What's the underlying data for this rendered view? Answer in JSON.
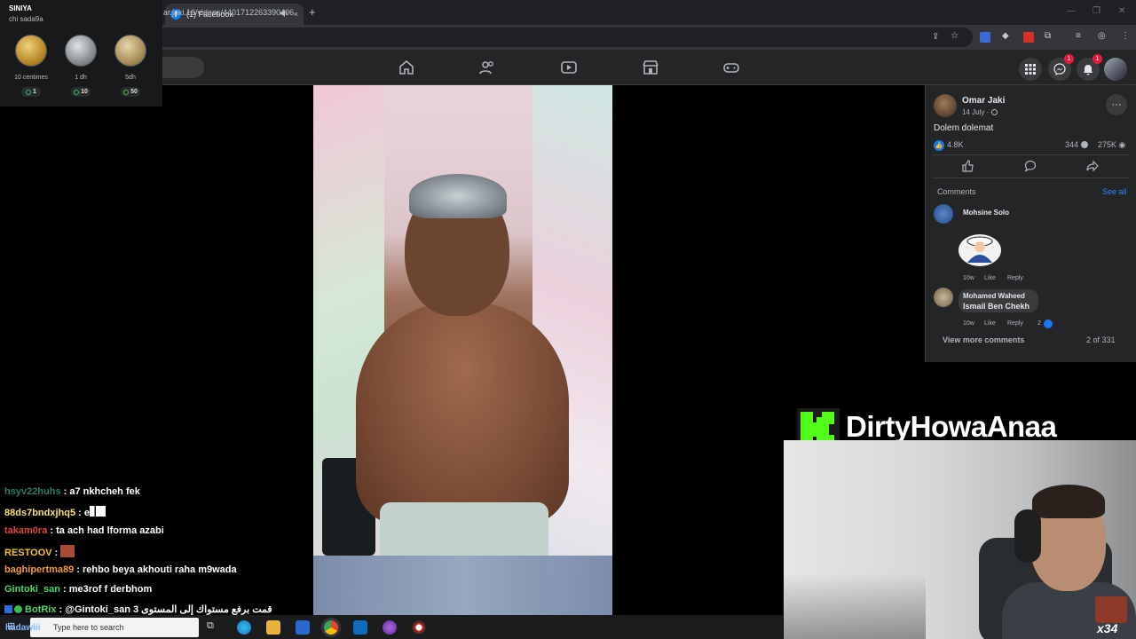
{
  "browser": {
    "tab_title": "(1) Facebook",
    "url": "ar.jaki.16/videos/4401712263390406",
    "tab_audio_icon": "speaker-icon",
    "tab_close": "×",
    "new_tab": "+"
  },
  "coins_widget": {
    "title": "SINIYA",
    "subtitle": "chi sada9a",
    "coins": [
      {
        "label": "10 centimes",
        "points": "1",
        "color": "#c9a23a"
      },
      {
        "label": "1 dh",
        "points": "10",
        "color": "#a0a4a8"
      },
      {
        "label": "5dh",
        "points": "50",
        "color": "#c9b07a"
      }
    ]
  },
  "facebook": {
    "nav_icons": [
      "home-icon",
      "friends-icon",
      "watch-icon",
      "marketplace-icon",
      "gaming-icon"
    ],
    "messenger_badge": "1",
    "notifications_badge": "1"
  },
  "post": {
    "author": "Omar Jaki",
    "date": "14 July ·",
    "more": "···",
    "text": "Dolem dolemat",
    "reactions": "4.8K",
    "comments_count": "344",
    "views": "275K",
    "comments_heading": "Comments",
    "see_all": "See all",
    "comments": [
      {
        "author": "Mohsine Solo",
        "text": "",
        "time": "10w",
        "like": "Like",
        "reply": "Reply",
        "reaction_count": ""
      },
      {
        "author": "Mohamed Waheed",
        "text": "Ismail Ben Chekh",
        "time": "10w",
        "like": "Like",
        "reply": "Reply",
        "reaction_count": "2"
      }
    ],
    "view_more": "View more comments",
    "pagination": "2 of 331"
  },
  "stream": {
    "brand_name": "DirtyHowaAnaa",
    "brand_color": "#53fc18",
    "sub_count": "x34"
  },
  "chat": [
    {
      "user": "hsyv22huhs",
      "color": "#2e7d5b",
      "text": " : a7 nkhcheh fek"
    },
    {
      "user": "88ds7bndxjhq5",
      "color": "#f6e27a",
      "text": " : e"
    },
    {
      "user": "takam0ra",
      "color": "#e0453a",
      "text": " : ta ach had lforma azabi"
    },
    {
      "user": "RESTOOV",
      "color": "#f1c232",
      "text": " : "
    },
    {
      "user": "baghipertma89",
      "color": "#f39c3a",
      "text": " : rehbo beya akhouti raha m9wada"
    },
    {
      "user": "Gintoki_san",
      "color": "#4ad66d",
      "text": " : me3rof f derbhom"
    },
    {
      "user": "BotRix",
      "color": "#4ad66d",
      "text": " : @Gintoki_san 3 قمت برفع مستواك إلى المستوى"
    }
  ],
  "taskbar": {
    "search_placeholder": "Type here to search",
    "username_overlay": "hadawiii"
  }
}
